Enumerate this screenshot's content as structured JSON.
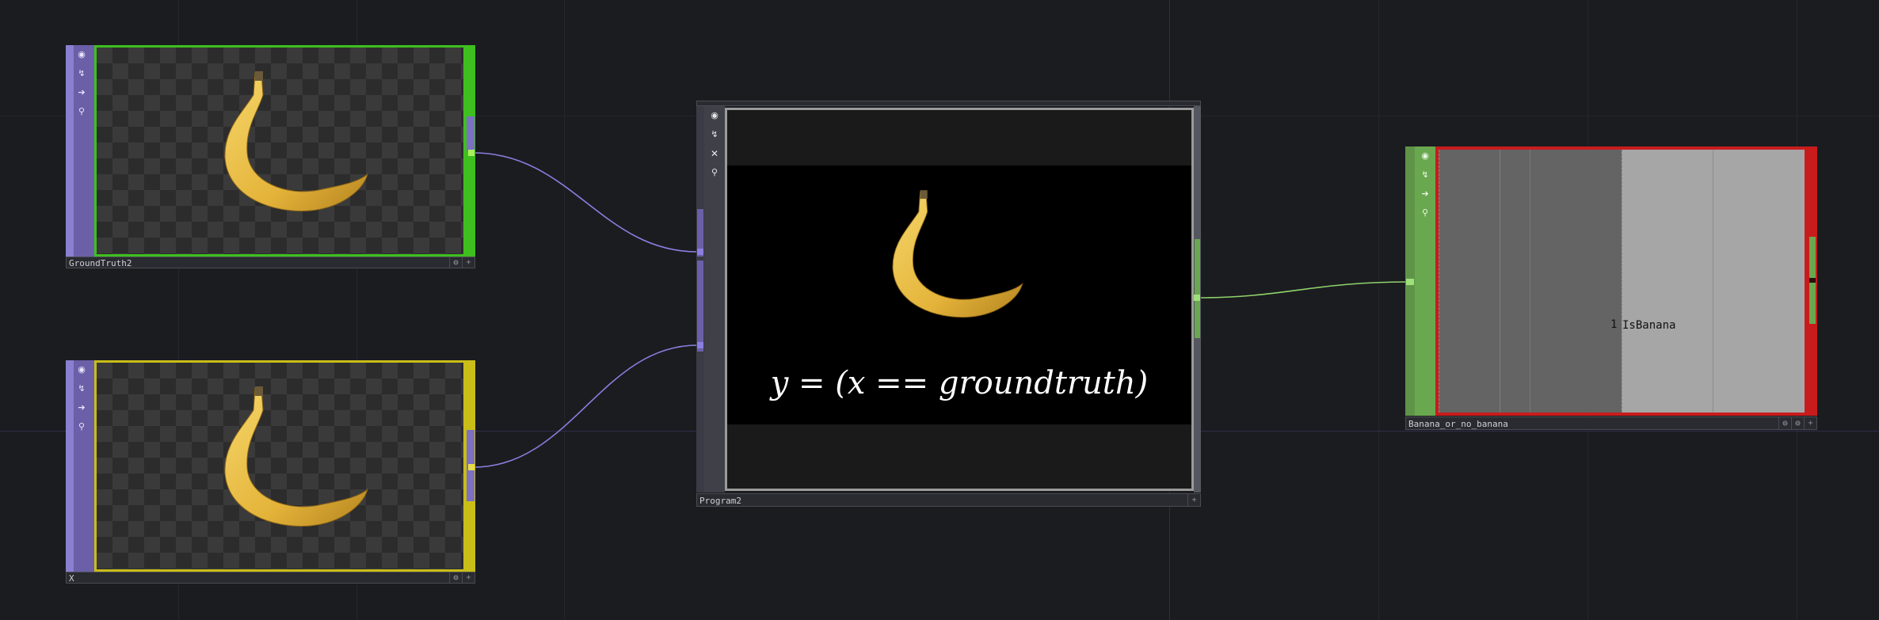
{
  "nodes": {
    "groundtruth": {
      "name": "GroundTruth2",
      "flag_color": "#3fbf1f",
      "tools": [
        "viewer-icon",
        "bypass-icon",
        "export-icon",
        "lock-icon"
      ]
    },
    "x": {
      "name": "X",
      "flag_color": "#c9bd18",
      "tools": [
        "viewer-icon",
        "bypass-icon",
        "export-icon",
        "lock-icon"
      ]
    },
    "program": {
      "name": "Program2",
      "formula": "y = (x == groundtruth)",
      "tools": [
        "viewer-icon",
        "bypass-icon",
        "close-icon",
        "lock-icon"
      ]
    },
    "banana_or_no_banana": {
      "name": "Banana_or_no_banana",
      "value_text": "1",
      "channel_name": "IsBanana",
      "flag_color": "#c81c1c",
      "tools": [
        "viewer-icon",
        "bypass-icon",
        "export-icon",
        "lock-icon"
      ]
    }
  },
  "colors": {
    "background": "#1b1c20",
    "wire_top": "#8a7fe0",
    "wire_output": "#8fd36a",
    "chop_node": "#6aa84f"
  }
}
